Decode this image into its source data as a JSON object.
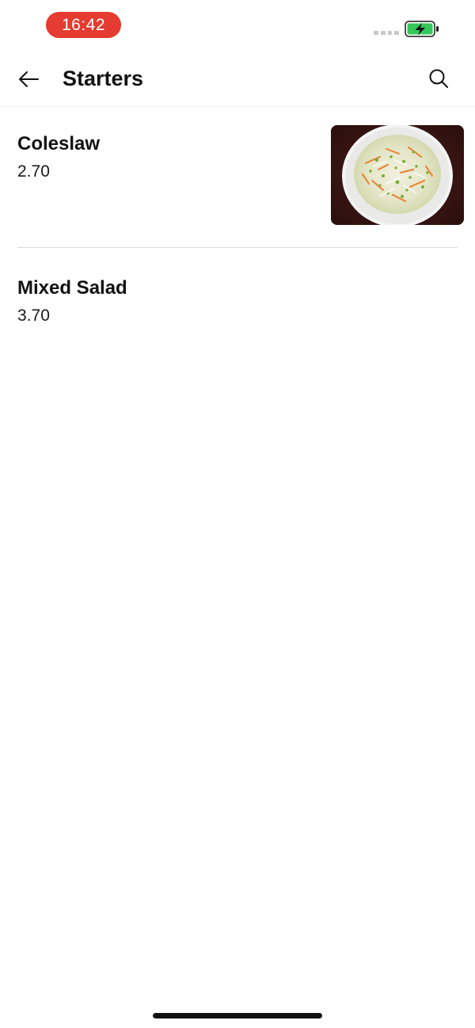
{
  "status_bar": {
    "time": "16:42",
    "time_pill_color": "#e53b30",
    "battery_icon": "battery-charging-icon",
    "battery_color": "#34c759",
    "signal_icon": "signal-dots-icon"
  },
  "header": {
    "title": "Starters",
    "back_icon": "arrow-left-icon",
    "search_icon": "search-icon"
  },
  "menu_items": [
    {
      "name": "Coleslaw",
      "price": "2.70",
      "image": "coleslaw-photo"
    },
    {
      "name": "Mixed Salad",
      "price": "3.70"
    }
  ],
  "accent_color": "#e53b30"
}
